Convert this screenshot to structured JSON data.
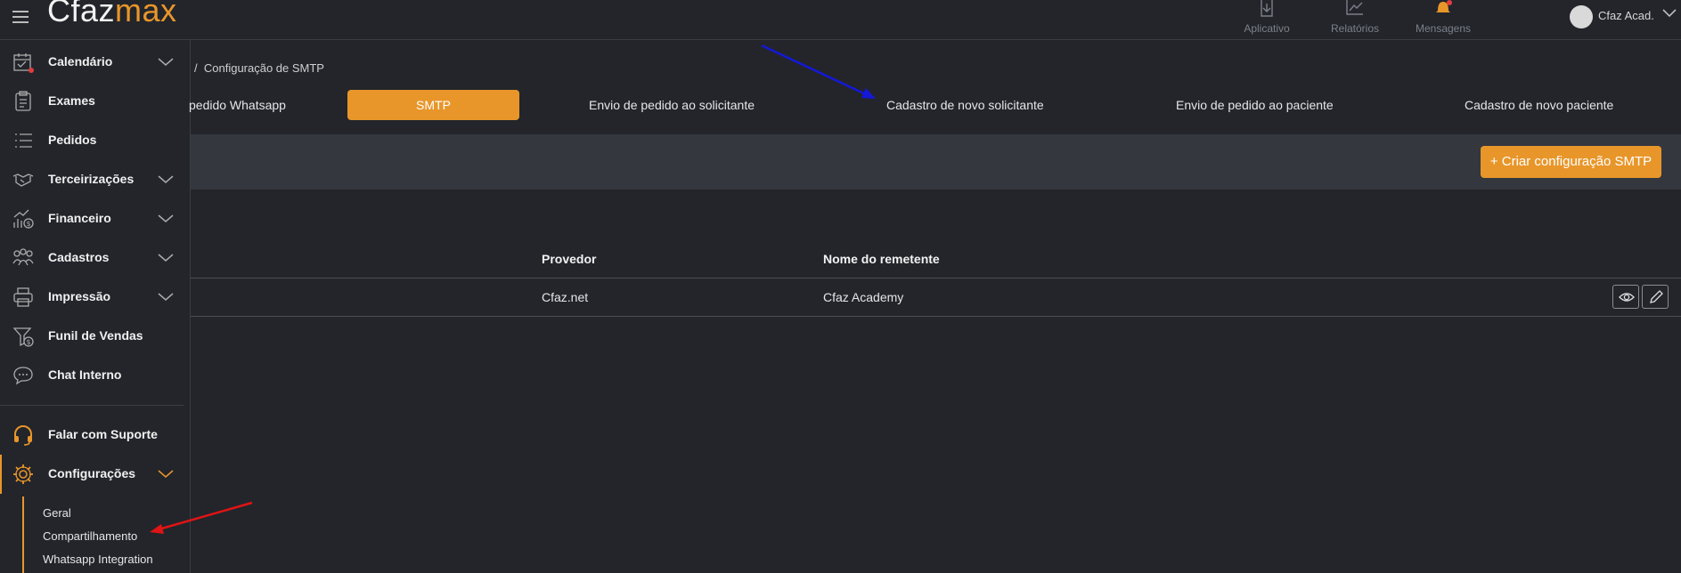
{
  "app": {
    "logo_part1": "Cfaz",
    "logo_part2": "max"
  },
  "header": {
    "nav": [
      {
        "label": "Aplicativo",
        "icon": "app-download-icon"
      },
      {
        "label": "Relatórios",
        "icon": "chart-icon"
      },
      {
        "label": "Mensagens",
        "icon": "bell-icon"
      }
    ],
    "user": {
      "name": "Cfaz Acad."
    }
  },
  "sidebar": {
    "items": [
      {
        "label": "Calendário",
        "icon": "calendar-icon",
        "expandable": true
      },
      {
        "label": "Exames",
        "icon": "clipboard-icon",
        "expandable": false
      },
      {
        "label": "Pedidos",
        "icon": "list-icon",
        "expandable": false
      },
      {
        "label": "Terceirizações",
        "icon": "handshake-icon",
        "expandable": true
      },
      {
        "label": "Financeiro",
        "icon": "finance-icon",
        "expandable": true
      },
      {
        "label": "Cadastros",
        "icon": "users-icon",
        "expandable": true
      },
      {
        "label": "Impressão",
        "icon": "printer-icon",
        "expandable": true
      },
      {
        "label": "Funil de Vendas",
        "icon": "funnel-icon",
        "expandable": false
      },
      {
        "label": "Chat Interno",
        "icon": "chat-icon",
        "expandable": false
      }
    ],
    "support": {
      "label": "Falar com Suporte",
      "icon": "headset-icon"
    },
    "settings": {
      "label": "Configurações",
      "icon": "gear-icon"
    },
    "submenu": [
      "Geral",
      "Compartilhamento",
      "Whatsapp Integration"
    ]
  },
  "breadcrumb": {
    "separator": "/",
    "current": "Configuração de SMTP"
  },
  "tabs": [
    {
      "label": "pedido Whatsapp",
      "active": false
    },
    {
      "label": "SMTP",
      "active": true
    },
    {
      "label": "Envio de pedido ao solicitante",
      "active": false
    },
    {
      "label": "Cadastro de novo solicitante",
      "active": false
    },
    {
      "label": "Envio de pedido ao paciente",
      "active": false
    },
    {
      "label": "Cadastro de novo paciente",
      "active": false
    }
  ],
  "toolbar": {
    "create_label": "+ Criar configuração SMTP"
  },
  "table": {
    "columns": [
      "Provedor",
      "Nome do remetente"
    ],
    "rows": [
      {
        "provedor": "Cfaz.net",
        "remetente": "Cfaz Academy"
      }
    ]
  },
  "colors": {
    "accent": "#e8962a",
    "background": "#23252b",
    "toolbar": "#34373e"
  }
}
